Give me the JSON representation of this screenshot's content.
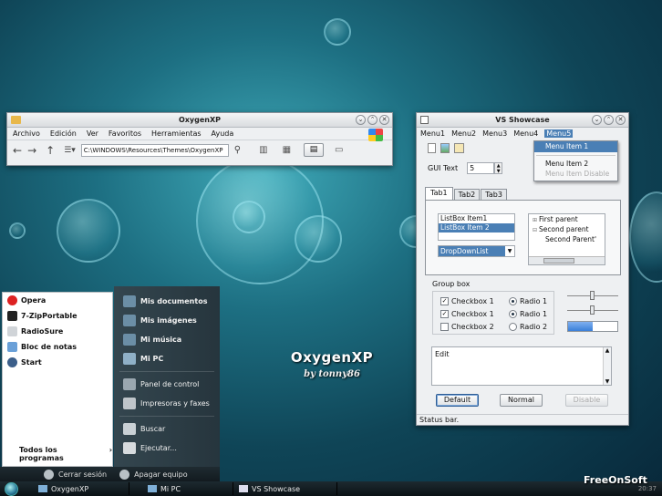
{
  "desktop": {
    "logo_title": "OxygenXP",
    "logo_author": "by tonny86",
    "watermark": "FreeOnSoft"
  },
  "explorer": {
    "title": "OxygenXP",
    "menu": [
      "Archivo",
      "Edición",
      "Ver",
      "Favoritos",
      "Herramientas",
      "Ayuda"
    ],
    "address": "C:\\WINDOWS\\Resources\\Themes\\OxygenXP"
  },
  "showcase": {
    "title": "VS Showcase",
    "menu": [
      "Menu1",
      "Menu2",
      "Menu3",
      "Menu4",
      "Menu5"
    ],
    "dropdown": [
      "Menu Item 1",
      "Menu Item 2",
      "Menu Item Disable"
    ],
    "gui_label": "GUI Text",
    "gui_value": "5",
    "tabs": [
      "Tab1",
      "Tab2",
      "Tab3"
    ],
    "listbox": [
      "ListBox Item1",
      "ListBox Item 2"
    ],
    "droplist": "DropDownList",
    "tree": [
      "First parent",
      "Second parent",
      "Second Parent'"
    ],
    "groupbox_label": "Group box",
    "checkboxes": [
      {
        "label": "Checkbox 1",
        "checked": true
      },
      {
        "label": "Checkbox 1",
        "checked": true
      },
      {
        "label": "Checkbox 2",
        "checked": false
      }
    ],
    "radios": [
      {
        "label": "Radio 1",
        "checked": true
      },
      {
        "label": "Radio 1",
        "checked": true
      },
      {
        "label": "Radio 2",
        "checked": false
      }
    ],
    "textarea": "Edit",
    "buttons": {
      "default": "Default",
      "normal": "Normal",
      "disable": "Disable"
    },
    "status": "Status bar."
  },
  "startmenu": {
    "left_items": [
      "Opera",
      "7-ZipPortable",
      "RadioSure",
      "Bloc de notas",
      "Start"
    ],
    "all_programs": "Todos los programas",
    "right_items": [
      "Mis documentos",
      "Mis imágenes",
      "Mi música",
      "Mi PC",
      "Panel de control",
      "Impresoras y faxes",
      "Buscar",
      "Ejecutar..."
    ],
    "logoff": "Cerrar sesión",
    "shutdown": "Apagar equipo"
  },
  "taskbar": {
    "tasks": [
      "OxygenXP",
      "Mi PC",
      "VS Showcase"
    ],
    "clock": "20:37"
  },
  "colors": {
    "accent": "#4a7fb5",
    "progress": "#3a7fd8"
  }
}
